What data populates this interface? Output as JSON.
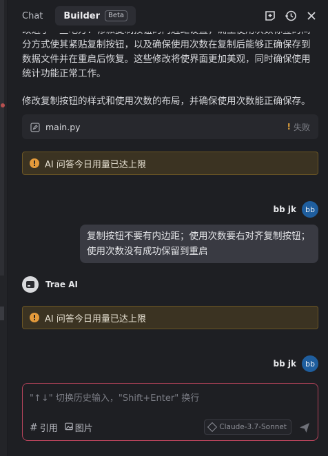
{
  "tabs": [
    {
      "label": "Chat"
    },
    {
      "label": "Builder",
      "badge": "Beta"
    }
  ],
  "header_icons": [
    "new-chat-icon",
    "history-icon",
    "close-icon"
  ],
  "messages": {
    "intro_text": "改进了一些地方：修派复制按钮的内边距设置，确至使用次数标签的间分方式使其紧贴复制按钮，以及确保使用次数在复制后能够正确保存到数据文件并在重启后恢复。这些修改将使界面更加美观，同时确保使用统计功能正常工作。",
    "summary_text": "修改复制按钮的样式和使用次数的布局，并确保使用次数能正确保存。",
    "file": {
      "name": "main.py",
      "status": "失败"
    },
    "warning_1": "AI 问答今日用量已达上限",
    "user_1": {
      "name": "bb jk",
      "avatar": "bb"
    },
    "user_1_text": "复制按钮不要有内边距；使用次数要右对齐复制按钮；使用次数没有成功保留到重启",
    "ai": {
      "name": "Trae AI"
    },
    "warning_2": "AI 问答今日用量已达上限",
    "user_2": {
      "name": "bb jk",
      "avatar": "bb"
    }
  },
  "input": {
    "placeholder": "\"↑↓\" 切换历史输入，\"Shift+Enter\" 换行",
    "ref_label": "引用",
    "image_label": "图片",
    "model": "Claude-3.7-Sonnet"
  },
  "colors": {
    "background": "#1e1f23",
    "warning_bg": "#3b3322",
    "warning_icon": "#e39a3b",
    "avatar": "#1f5e9e",
    "input_border": "#b4435a"
  }
}
